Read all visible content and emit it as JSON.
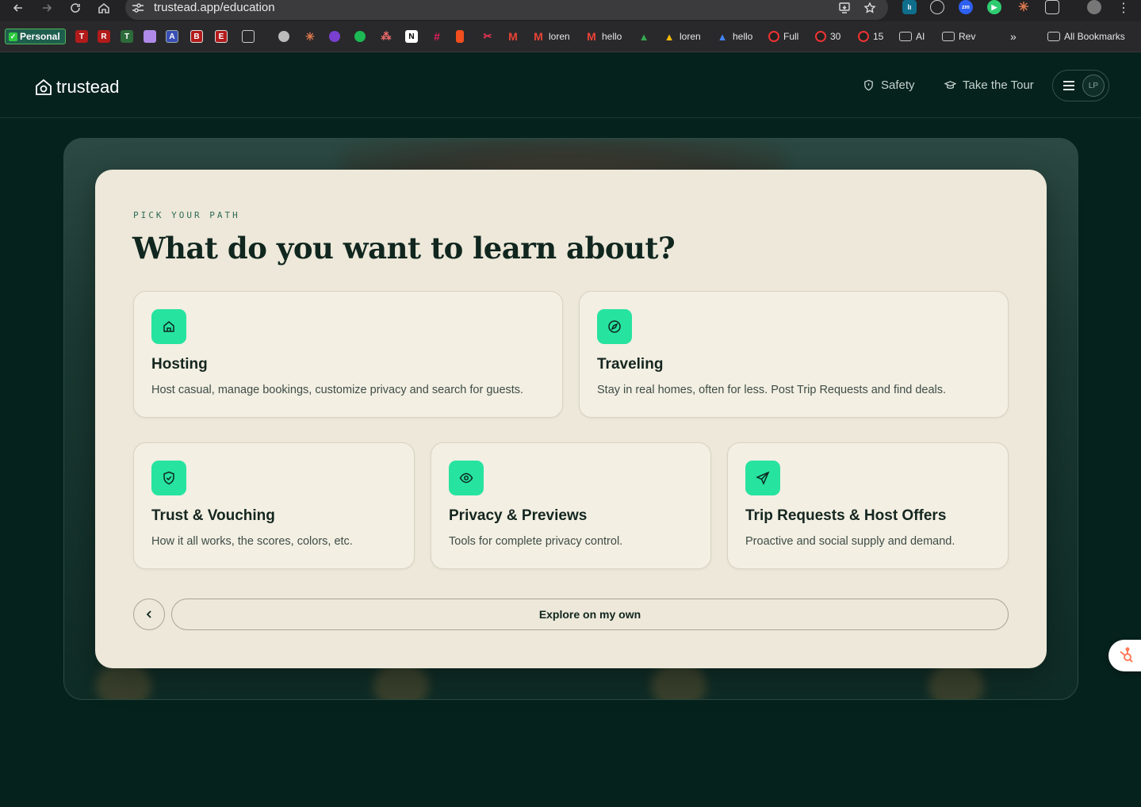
{
  "browser": {
    "url": "trustead.app/education",
    "bookmarks": {
      "personal": "Personal",
      "letters": [
        "T",
        "R",
        "T",
        "",
        "A",
        "B",
        "E"
      ],
      "named": [
        "loren",
        "hello",
        "loren",
        "hello",
        "Full",
        "30",
        "15",
        "AI",
        "Rev"
      ],
      "all_bookmarks": "All Bookmarks",
      "overflow": "»"
    }
  },
  "header": {
    "logo": "trustead",
    "nav": [
      "Safety",
      "Take the Tour"
    ],
    "avatar_initials": "LP"
  },
  "modal": {
    "eyebrow": "PICK YOUR PATH",
    "title": "What do you want to learn about?",
    "cards": [
      {
        "title": "Hosting",
        "desc": "Host casual, manage bookings, customize privacy and search for guests.",
        "icon": "home-icon"
      },
      {
        "title": "Traveling",
        "desc": "Stay in real homes, often for less. Post Trip Requests and find deals.",
        "icon": "compass-icon"
      },
      {
        "title": "Trust & Vouching",
        "desc": "How it all works, the scores, colors, etc.",
        "icon": "shield-check-icon"
      },
      {
        "title": "Privacy & Previews",
        "desc": "Tools for complete privacy control.",
        "icon": "eye-icon"
      },
      {
        "title": "Trip Requests & Host Offers",
        "desc": "Proactive and social supply and demand.",
        "icon": "send-icon"
      }
    ],
    "explore_label": "Explore on my own"
  },
  "colors": {
    "bg": "#06221d",
    "modal": "#ede8d9",
    "accent": "#27e3a0",
    "card": "#f3efe3"
  }
}
